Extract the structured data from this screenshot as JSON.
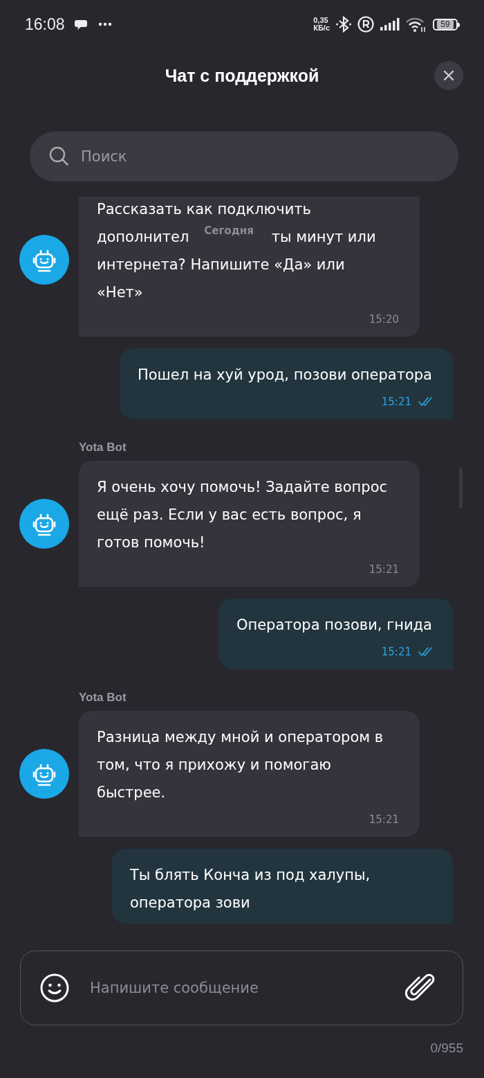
{
  "status_bar": {
    "time": "16:08",
    "speed_value": "0,35",
    "speed_unit": "КБ/с",
    "battery": "59"
  },
  "header": {
    "title": "Чат с поддержкой"
  },
  "search": {
    "placeholder": "Поиск"
  },
  "date_chip": "Сегодня",
  "messages": [
    {
      "kind": "bot",
      "lines": [
        "Рассказать как подключить",
        [
          "дополнител",
          "ты минут или"
        ],
        "интернета? Напишите «Да» или",
        "«Нет»"
      ],
      "time": "15:20"
    },
    {
      "kind": "user",
      "text": "Пошел на хуй урод, позови оператора",
      "time": "15:21",
      "read": true
    },
    {
      "kind": "bot",
      "sender": "Yota Bot",
      "text": "Я очень хочу помочь! Задайте вопрос ещё раз. Если у вас есть вопрос, я готов помочь!",
      "time": "15:21"
    },
    {
      "kind": "user",
      "text": "Оператора позови, гнида",
      "time": "15:21",
      "read": true
    },
    {
      "kind": "bot",
      "sender": "Yota Bot",
      "text": "Разница между мной и оператором в том, что я прихожу и помогаю быстрее.",
      "time": "15:21"
    },
    {
      "kind": "user",
      "text": "Ты блять Конча из под халупы, оператора зови"
    }
  ],
  "composer": {
    "placeholder": "Напишите сообщение",
    "counter": "0/955"
  }
}
